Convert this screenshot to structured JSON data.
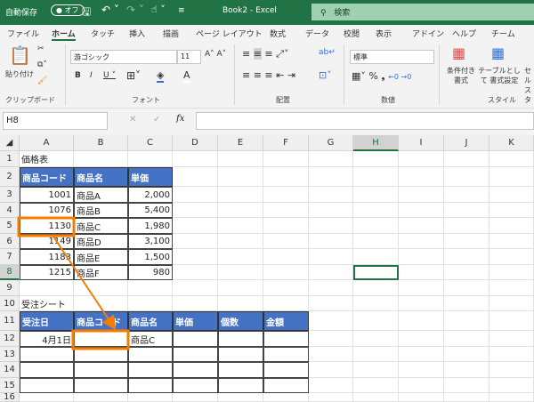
{
  "titlebar": {
    "autosave": "自動保存",
    "toggle": "● オフ",
    "title": "Book2 - Excel",
    "search": "検索"
  },
  "tabs": [
    "ファイル",
    "ホーム",
    "タッチ",
    "挿入",
    "描画",
    "ページ レイアウト",
    "数式",
    "データ",
    "校閲",
    "表示",
    "アドイン",
    "ヘルプ",
    "チーム"
  ],
  "ribbon": {
    "paste": "貼り付け",
    "clipboard": "クリップボード",
    "font_name": "游ゴシック",
    "font_size": "11",
    "font_group": "フォント",
    "align_group": "配置",
    "number_format": "標準",
    "number_group": "数値",
    "cond_format": "条件付き 書式",
    "table_format": "テーブルとして 書式設定",
    "cell_style": "セル スタ",
    "style_group": "スタイル"
  },
  "formula_bar": {
    "name_box": "H8",
    "fx": "fx",
    "value": ""
  },
  "columns": [
    "A",
    "B",
    "C",
    "D",
    "E",
    "F",
    "G",
    "H",
    "I",
    "J",
    "K"
  ],
  "selected": {
    "col": "H",
    "row": 8
  },
  "sheet": {
    "A1": "価格表",
    "A2": "商品コード",
    "B2": "商品名",
    "C2": "単価",
    "A3": "1001",
    "B3": "商品A",
    "C3": "2,000",
    "A4": "1076",
    "B4": "商品B",
    "C4": "5,400",
    "A5": "1130",
    "B5": "商品C",
    "C5": "1,980",
    "A6": "1149",
    "B6": "商品D",
    "C6": "3,100",
    "A7": "1183",
    "B7": "商品E",
    "C7": "1,500",
    "A8": "1215",
    "B8": "商品F",
    "C8": "980",
    "A10": "受注シート",
    "A11": "受注日",
    "B11": "商品コード",
    "C11": "商品名",
    "D11": "単価",
    "E11": "個数",
    "F11": "金額",
    "A12": "4月1日",
    "B12": "",
    "C12": "商品C"
  },
  "colors": {
    "accent": "#217346",
    "header_fill": "#4472c4",
    "highlight": "#f57c00"
  }
}
